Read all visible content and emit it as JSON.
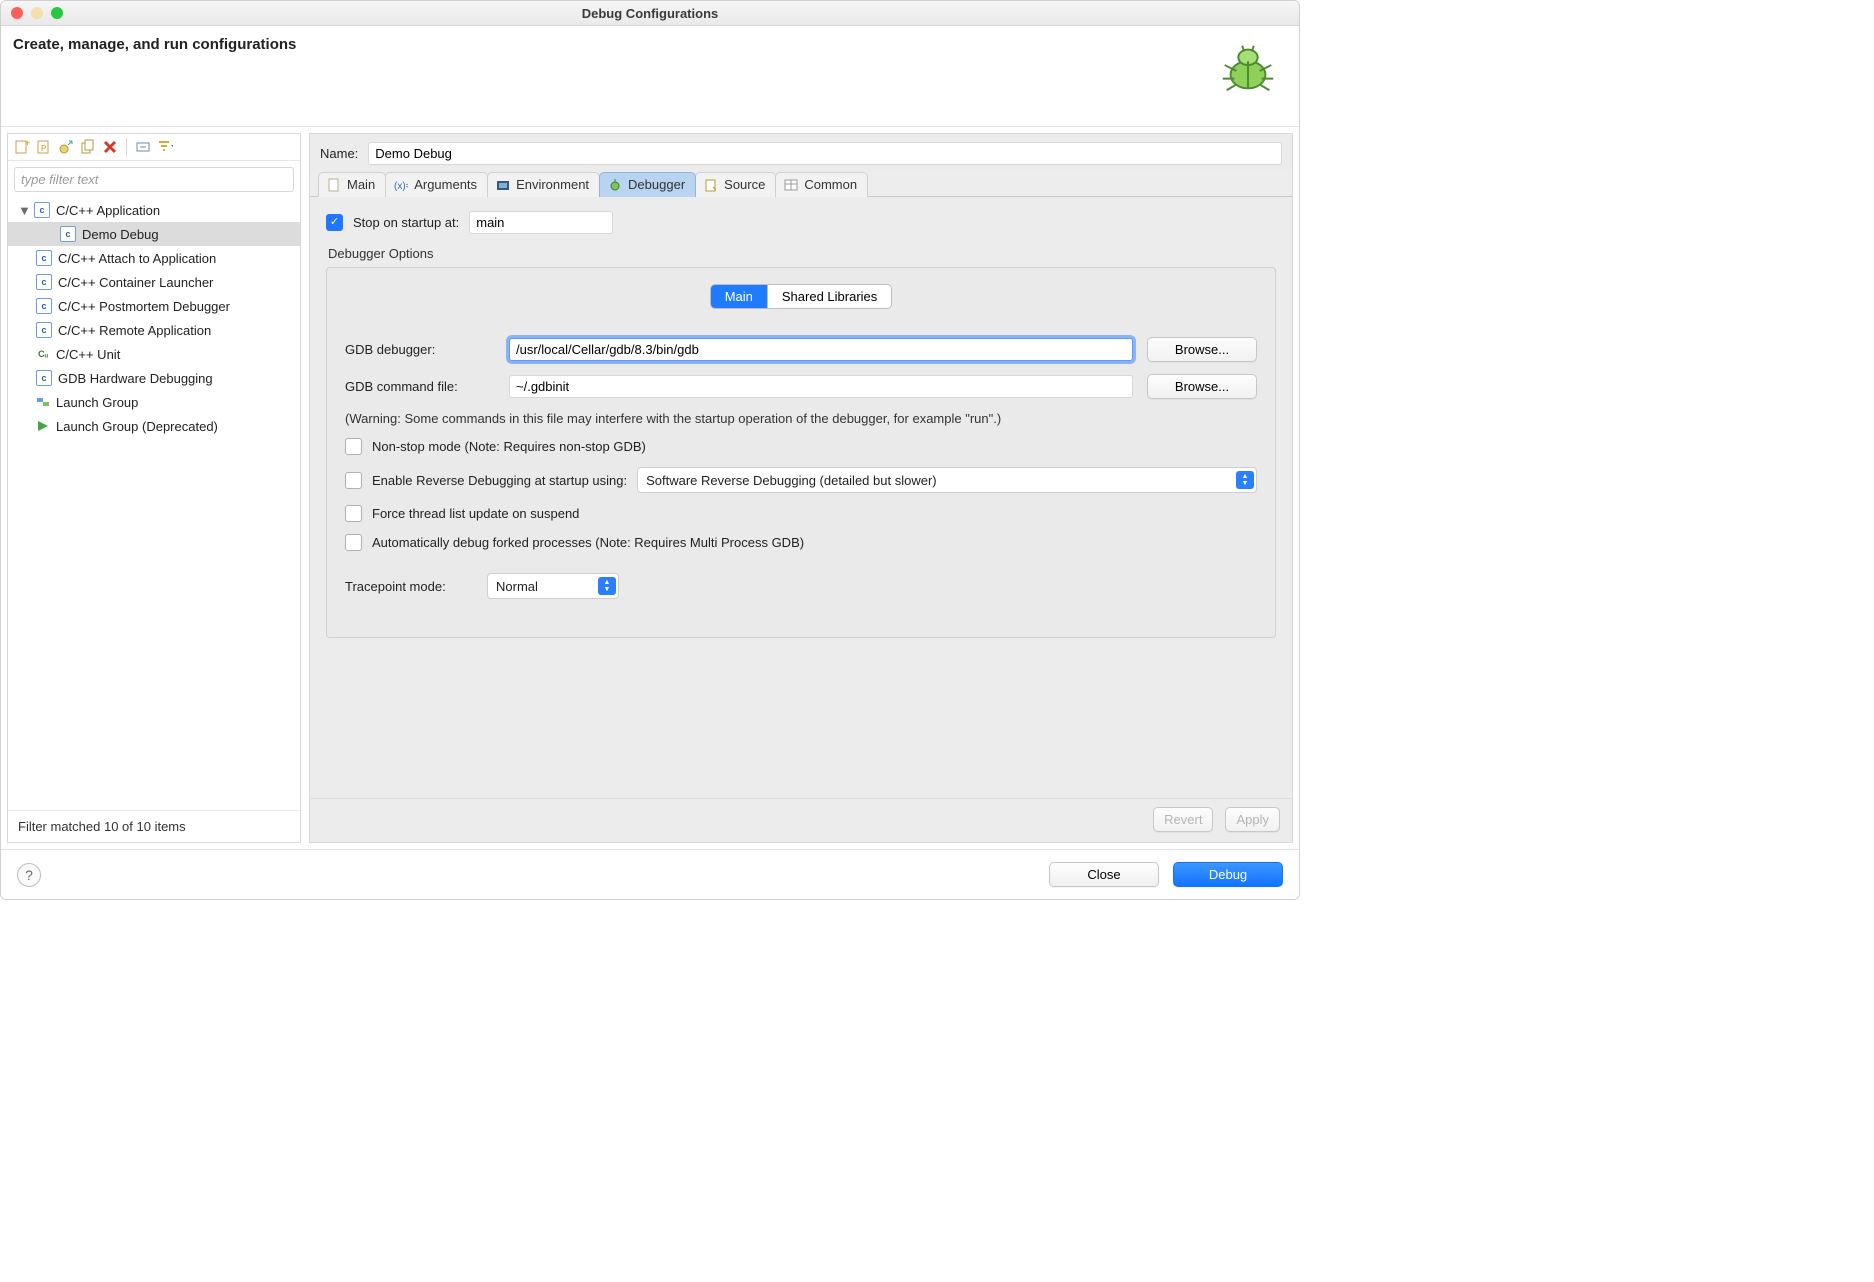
{
  "window": {
    "title": "Debug Configurations"
  },
  "header": {
    "title": "Create, manage, and run configurations"
  },
  "sidebar": {
    "filter_placeholder": "type filter text",
    "status": "Filter matched 10 of 10 items",
    "items": [
      {
        "label": "C/C++ Application",
        "icon": "c",
        "expandable": true,
        "expanded": true
      },
      {
        "label": "Demo Debug",
        "icon": "c",
        "child": true,
        "selected": true
      },
      {
        "label": "C/C++ Attach to Application",
        "icon": "c"
      },
      {
        "label": "C/C++ Container Launcher",
        "icon": "c"
      },
      {
        "label": "C/C++ Postmortem Debugger",
        "icon": "c"
      },
      {
        "label": "C/C++ Remote Application",
        "icon": "c"
      },
      {
        "label": "C/C++ Unit",
        "icon": "cu"
      },
      {
        "label": "GDB Hardware Debugging",
        "icon": "c"
      },
      {
        "label": "Launch Group",
        "icon": "group"
      },
      {
        "label": "Launch Group (Deprecated)",
        "icon": "play"
      }
    ]
  },
  "form": {
    "name_label": "Name:",
    "name_value": "Demo Debug",
    "tabs": [
      {
        "label": "Main",
        "icon": "doc"
      },
      {
        "label": "Arguments",
        "icon": "args"
      },
      {
        "label": "Environment",
        "icon": "env"
      },
      {
        "label": "Debugger",
        "icon": "bug",
        "active": true
      },
      {
        "label": "Source",
        "icon": "src"
      },
      {
        "label": "Common",
        "icon": "table"
      }
    ],
    "debugger": {
      "stop_label": "Stop on startup at:",
      "stop_checked": true,
      "stop_value": "main",
      "options_label": "Debugger Options",
      "seg": {
        "a": "Main",
        "b": "Shared Libraries"
      },
      "gdb_label": "GDB debugger:",
      "gdb_value": "/usr/local/Cellar/gdb/8.3/bin/gdb",
      "gdbcmd_label": "GDB command file:",
      "gdbcmd_value": "~/.gdbinit",
      "browse": "Browse...",
      "warning": "(Warning: Some commands in this file may interfere with the startup operation of the debugger, for example \"run\".)",
      "nonstop": "Non-stop mode (Note: Requires non-stop GDB)",
      "reverse_label": "Enable Reverse Debugging at startup using:",
      "reverse_option": "Software Reverse Debugging (detailed but slower)",
      "force": "Force thread list update on suspend",
      "autofork": "Automatically debug forked processes (Note: Requires Multi Process GDB)",
      "tracepoint_label": "Tracepoint mode:",
      "tracepoint_value": "Normal"
    },
    "buttons": {
      "revert": "Revert",
      "apply": "Apply"
    }
  },
  "footer": {
    "close": "Close",
    "debug": "Debug"
  }
}
